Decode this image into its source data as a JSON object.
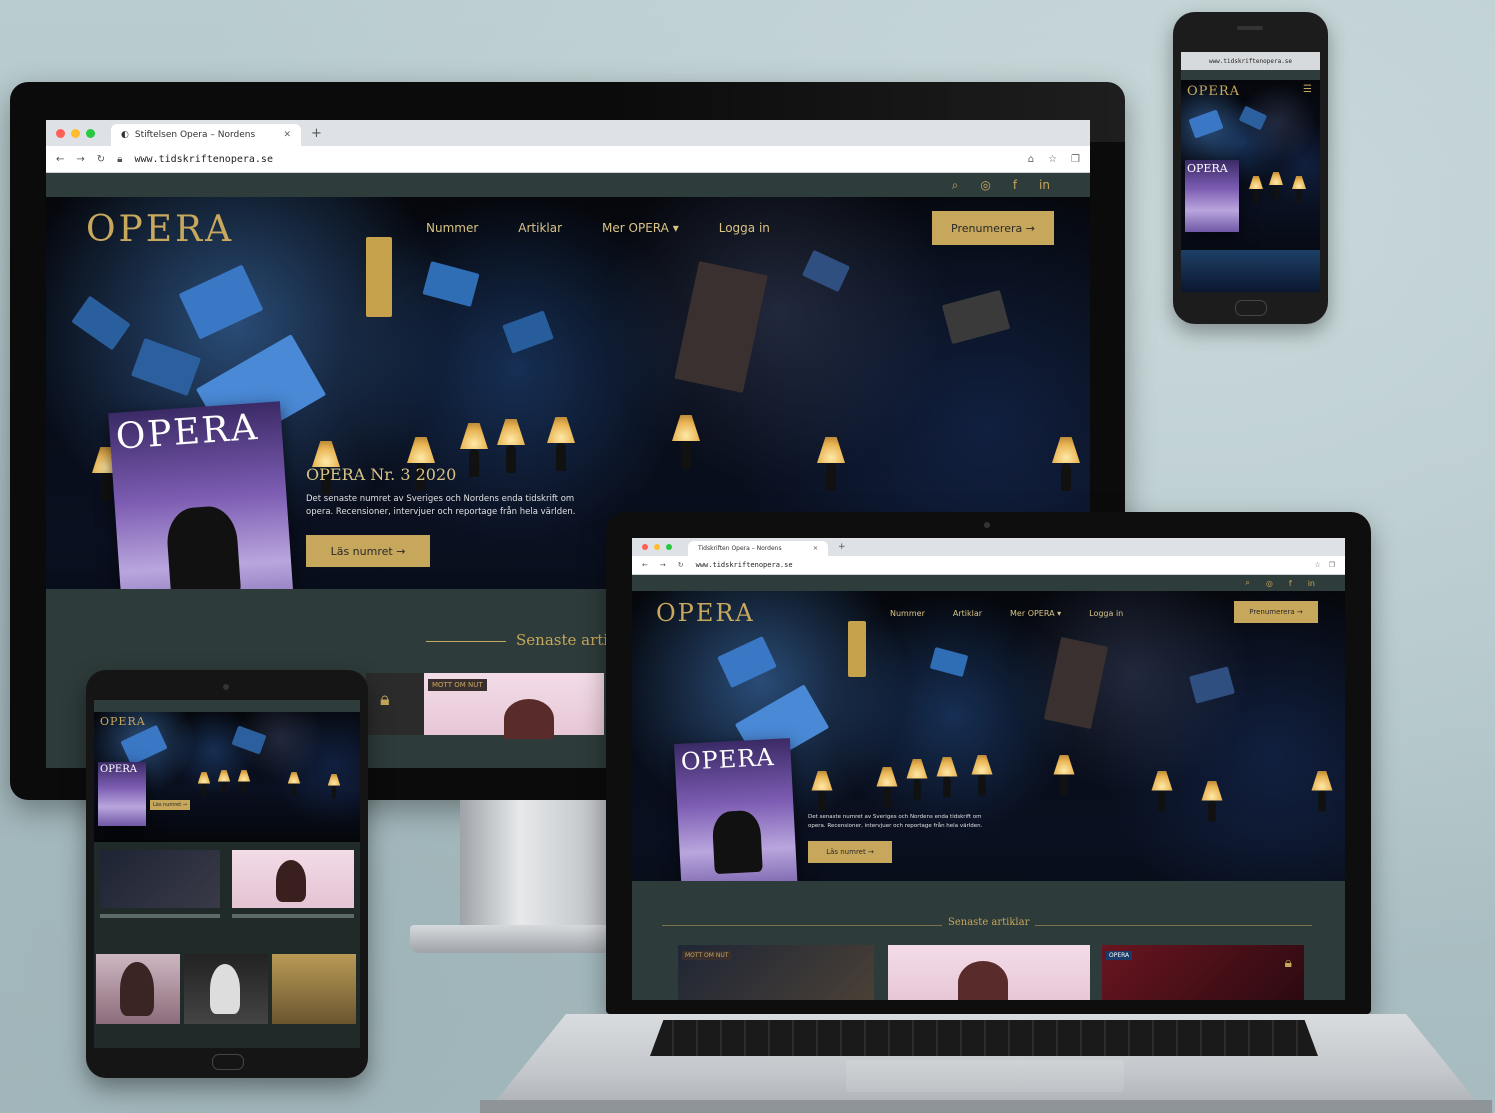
{
  "browser": {
    "tab_title": "Stiftelsen Opera – Nordens",
    "url": "www.tidskriftenopera.se",
    "tab_title_small": "Tidskriften Opera – Nordens",
    "url_small": "www.tidskriftenopera.se"
  },
  "site": {
    "logo": "OPERA",
    "nav": {
      "item1": "Nummer",
      "item2": "Artiklar",
      "item3": "Mer OPERA",
      "item4": "Logga in"
    },
    "cta_desktop": "Prenumerera →",
    "cta_laptop": "Prenumerera →",
    "hero": {
      "issue_title": "OPERA Nr. 3 2020",
      "issue_text_line1": "Det senaste numret av Sveriges och Nordens enda tidskrift om",
      "issue_text_line2": "opera. Recensioner, intervjuer och reportage från hela världen.",
      "button": "Läs numret →",
      "button_small": "Läs numret →"
    },
    "magazine_title": "OPERA",
    "news_heading": "Senaste artiklar",
    "news_heading_small": "Senaste artiklar",
    "badges": {
      "b1": "MOTT OM NUT",
      "b2": "MOTT OM NUT",
      "b3": "OPERA"
    }
  },
  "colors": {
    "gold": "#c6a75b",
    "dark_green": "#2e3c3b",
    "hero_dark": "#05070c"
  },
  "icons": [
    "search-icon",
    "instagram-icon",
    "facebook-icon",
    "linkedin-icon",
    "lock-icon",
    "chevron-down-icon",
    "back-icon",
    "forward-icon",
    "reload-icon",
    "star-icon"
  ]
}
